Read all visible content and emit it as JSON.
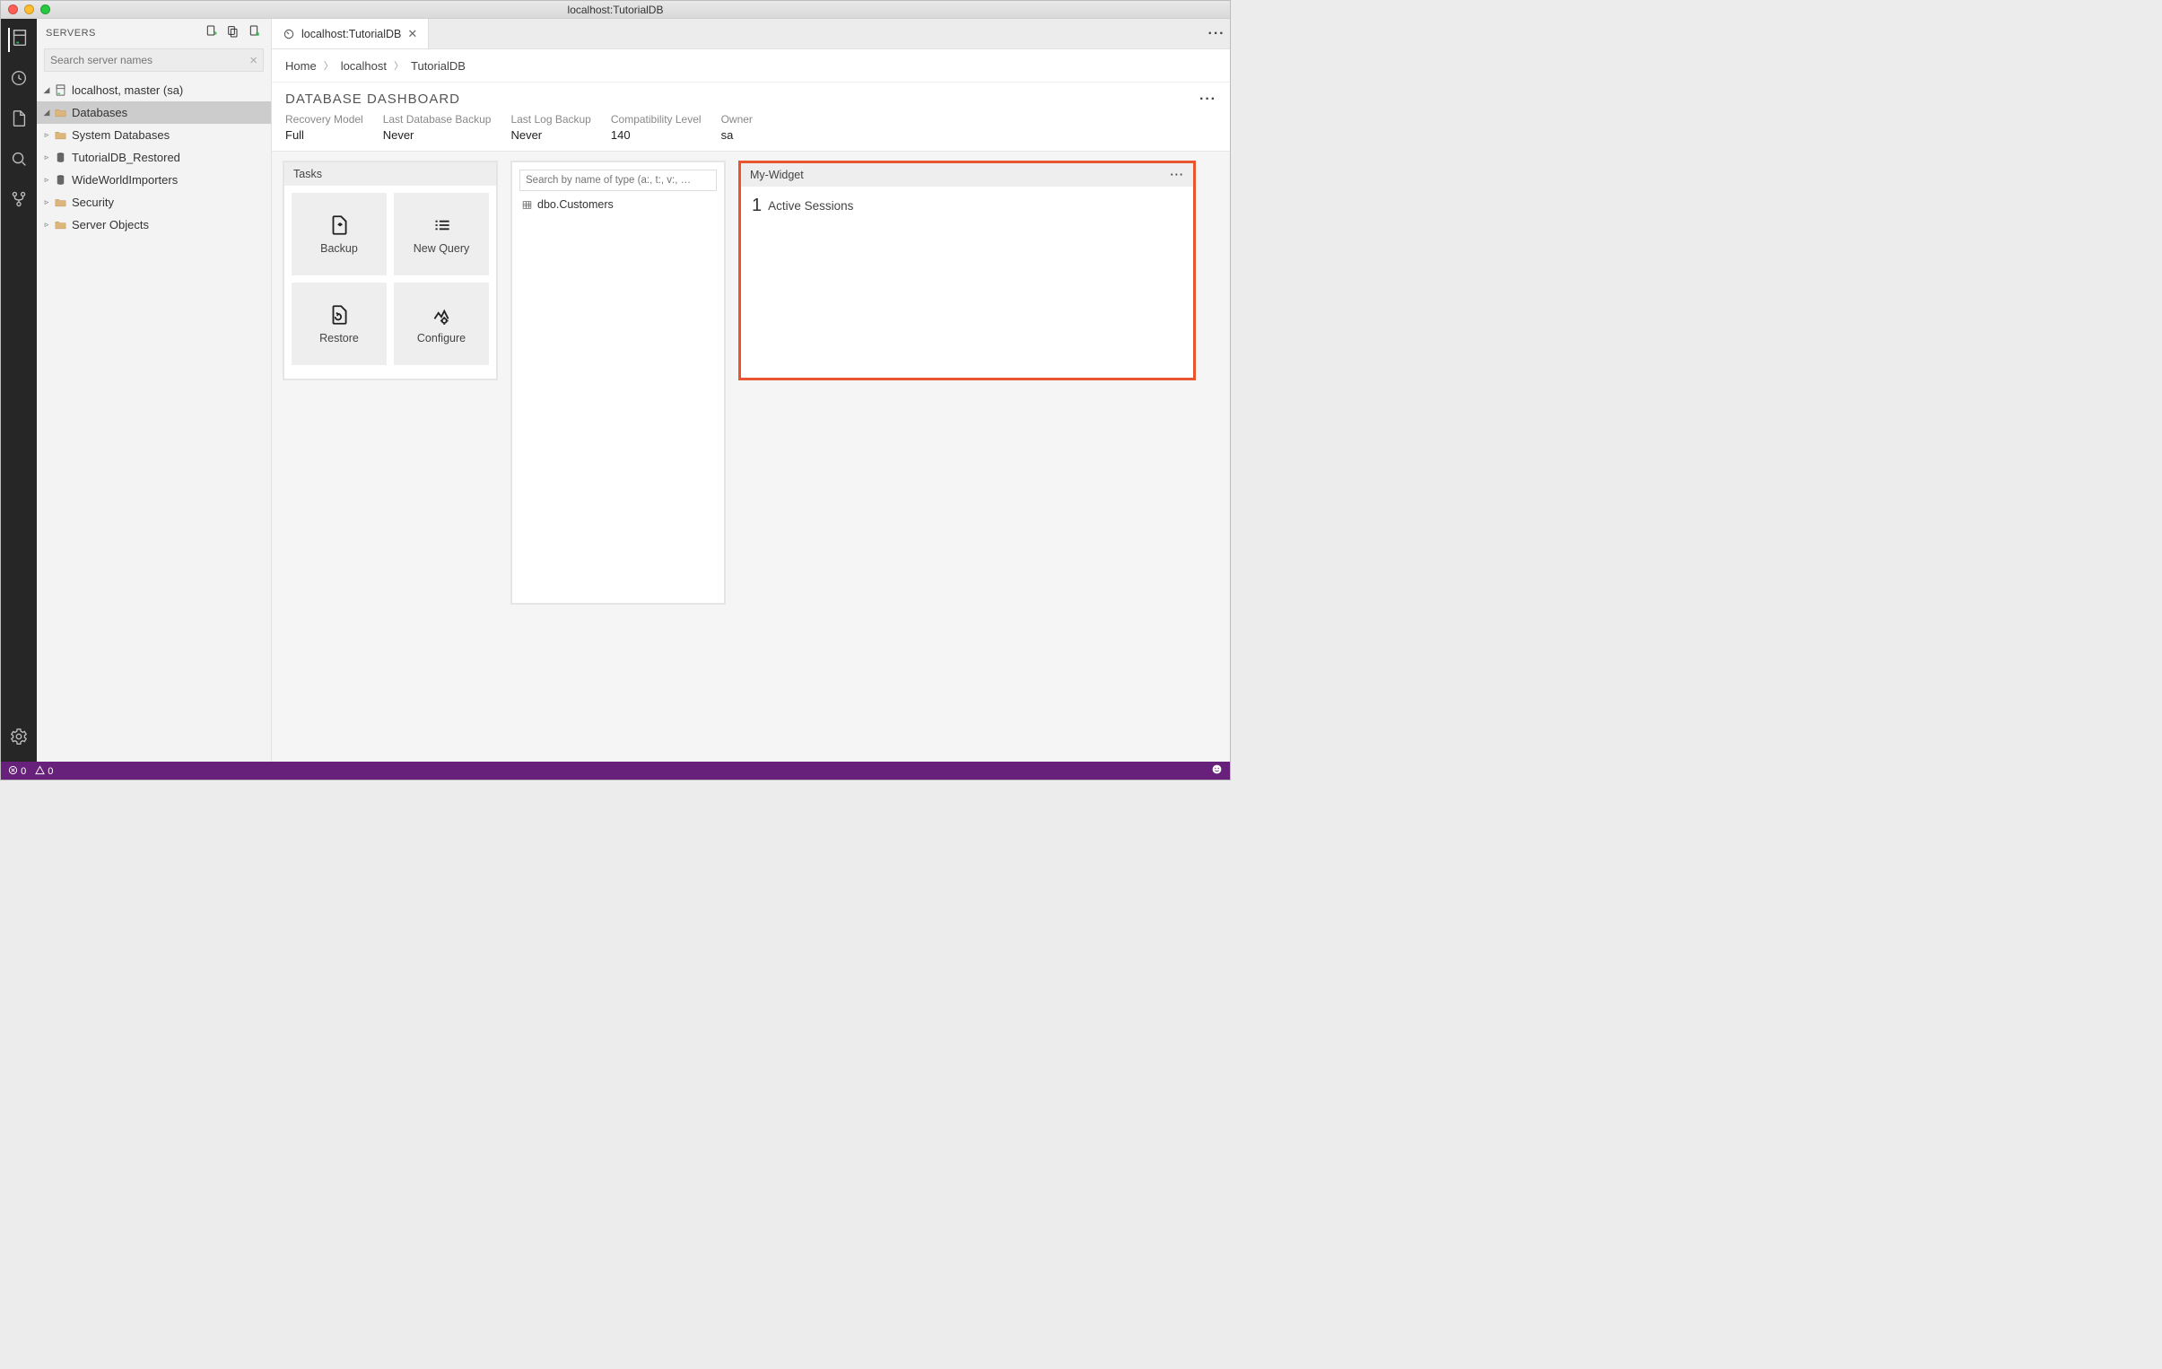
{
  "window": {
    "title": "localhost:TutorialDB"
  },
  "sidebar": {
    "title": "SERVERS",
    "search_placeholder": "Search server names",
    "tree": {
      "root": "localhost, master (sa)",
      "databases_label": "Databases",
      "items": [
        "System Databases",
        "TutorialDB_Restored",
        "WideWorldImporters"
      ],
      "security": "Security",
      "server_objects": "Server Objects"
    }
  },
  "tab": {
    "title": "localhost:TutorialDB"
  },
  "breadcrumb": {
    "a": "Home",
    "b": "localhost",
    "c": "TutorialDB"
  },
  "dashboard": {
    "heading": "DATABASE DASHBOARD",
    "props": {
      "recovery_label": "Recovery Model",
      "recovery_value": "Full",
      "lastbackup_label": "Last Database Backup",
      "lastbackup_value": "Never",
      "lastlog_label": "Last Log Backup",
      "lastlog_value": "Never",
      "compat_label": "Compatibility Level",
      "compat_value": "140",
      "owner_label": "Owner",
      "owner_value": "sa"
    }
  },
  "tasks": {
    "title": "Tasks",
    "backup": "Backup",
    "newquery": "New Query",
    "restore": "Restore",
    "configure": "Configure"
  },
  "search": {
    "placeholder": "Search by name of type (a:, t:, v:, …",
    "result0": "dbo.Customers"
  },
  "widget": {
    "title": "My-Widget",
    "count": "1",
    "label": "Active Sessions"
  },
  "statusbar": {
    "errors": "0",
    "warnings": "0"
  }
}
